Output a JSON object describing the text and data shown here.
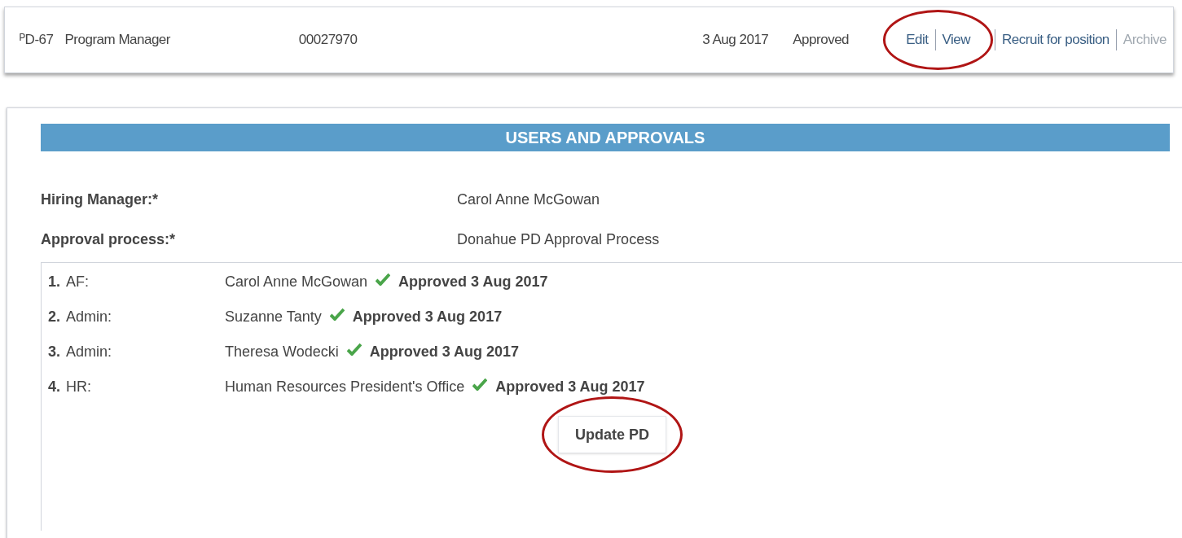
{
  "position_row": {
    "id": "ᴾD-67",
    "title": "Program Manager",
    "number": "00027970",
    "date": "3 Aug 2017",
    "status": "Approved",
    "actions": [
      {
        "label": "Edit",
        "disabled": false,
        "circled": true
      },
      {
        "label": "View",
        "disabled": false,
        "circled": true
      },
      {
        "label": "Recruit for position",
        "disabled": false,
        "circled": false
      },
      {
        "label": "Archive",
        "disabled": true,
        "circled": false
      }
    ]
  },
  "section": {
    "title": "USERS AND APPROVALS",
    "fields": [
      {
        "label": "Hiring Manager:*",
        "value": "Carol Anne McGowan"
      },
      {
        "label": "Approval process:*",
        "value": "Donahue PD Approval Process"
      }
    ],
    "steps": [
      {
        "number": "1.",
        "role": "AF:",
        "name": "Carol Anne McGowan",
        "approved": true,
        "status": "Approved 3 Aug 2017"
      },
      {
        "number": "2.",
        "role": "Admin:",
        "name": "Suzanne Tanty",
        "approved": true,
        "status": "Approved 3 Aug 2017"
      },
      {
        "number": "3.",
        "role": "Admin:",
        "name": "Theresa Wodecki",
        "approved": true,
        "status": "Approved 3 Aug 2017"
      },
      {
        "number": "4.",
        "role": "HR:",
        "name": "Human Resources President's Office",
        "approved": true,
        "status": "Approved 3 Aug 2017"
      }
    ],
    "button": {
      "label": "Update PD",
      "circled": true
    }
  }
}
